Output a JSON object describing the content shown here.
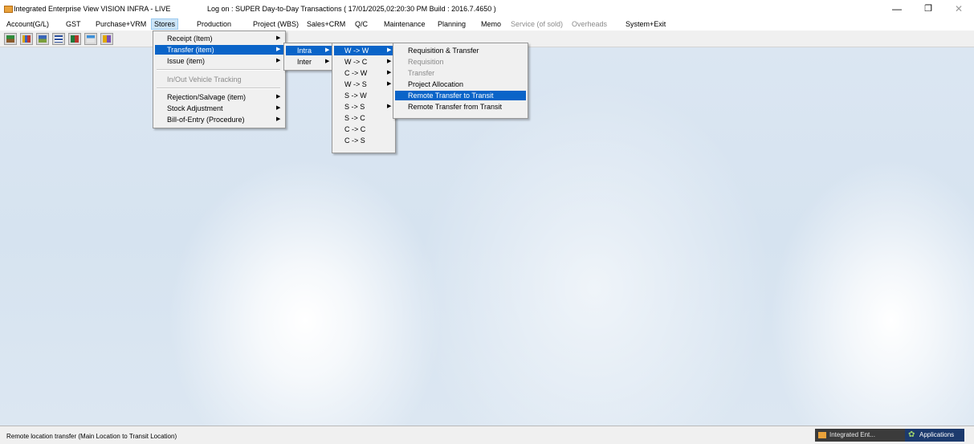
{
  "window": {
    "title": "Integrated Enterprise View  VISION INFRA - LIVE",
    "logon": "Log on : SUPER  Day-to-Day Transactions ( 17/01/2025,02:20:30 PM Build : 2016.7.4650 )",
    "controls": {
      "minimize": "—",
      "maximize": "❐",
      "close": "✕"
    }
  },
  "menubar": [
    "Account(G/L)",
    "GST",
    "Purchase+VRM",
    "Stores",
    "Production",
    "Project (WBS)",
    "Sales+CRM",
    "Q/C",
    "Maintenance",
    "Planning",
    "Memo",
    "Service (of sold)",
    "Overheads",
    "System+Exit"
  ],
  "stores_menu": [
    "Receipt (Item)",
    "Transfer (item)",
    "Issue (item)",
    "In/Out Vehicle Tracking",
    "Rejection/Salvage (item)",
    "Stock  Adjustment",
    "Bill-of-Entry (Procedure)"
  ],
  "transfer_menu": [
    "Intra",
    "Inter"
  ],
  "intra_menu": [
    "W -> W",
    "W -> C",
    "C -> W",
    "W -> S",
    "S -> W",
    "S -> S",
    "S -> C",
    "C -> C",
    "C -> S"
  ],
  "ww_menu": [
    "Requisition & Transfer",
    "Requisition",
    "Transfer",
    "Project Allocation",
    "Remote Transfer to Transit",
    "Remote Transfer from Transit"
  ],
  "submenu_arrow": "▶",
  "statusbar": {
    "text": "Remote location transfer (Main Location to Transit Location)",
    "task_integrated": "Integrated Ent...",
    "task_apps": "Applications"
  },
  "colors": {
    "highlight": "#0a64c8",
    "menu_bg": "#f0f0f0",
    "desktop": "#dbe6f2"
  }
}
